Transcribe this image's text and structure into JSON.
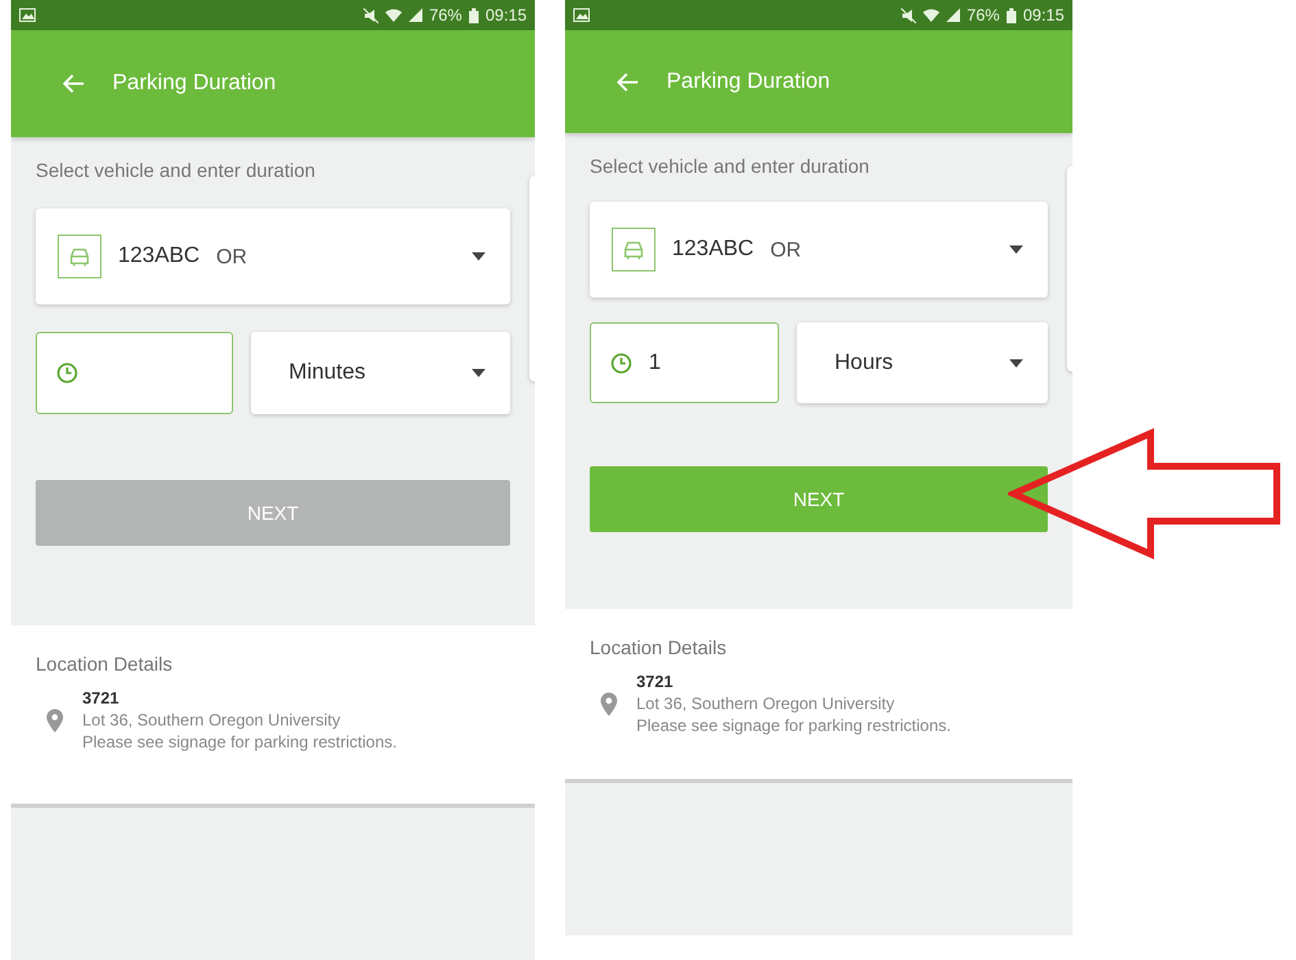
{
  "screens": [
    {
      "status_bar": {
        "battery": "76%",
        "time": "09:15"
      },
      "title": "Parking Duration",
      "prompt": "Select vehicle and enter duration",
      "vehicle": {
        "plate": "123ABC",
        "state": "OR"
      },
      "duration": {
        "unit": "Minutes"
      },
      "next": {
        "label": "NEXT",
        "enabled": false
      },
      "location": {
        "heading": "Location Details",
        "id": "3721",
        "lot": "Lot 36, Southern Oregon University",
        "note": "Please see signage for parking restrictions."
      }
    },
    {
      "status_bar": {
        "battery": "76%",
        "time": "09:15"
      },
      "title": "Parking Duration",
      "prompt": "Select vehicle and enter duration",
      "vehicle": {
        "plate": "123ABC",
        "state": "OR"
      },
      "duration": {
        "value": "1",
        "unit": "Hours"
      },
      "next": {
        "label": "NEXT",
        "enabled": true
      },
      "location": {
        "heading": "Location Details",
        "id": "3721",
        "lot": "Lot 36, Southern Oregon University",
        "note": "Please see signage for parking restrictions."
      }
    }
  ]
}
